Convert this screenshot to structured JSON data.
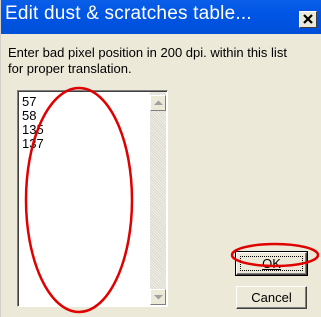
{
  "window": {
    "title": "Edit dust & scratches table...",
    "close_icon": "close-icon"
  },
  "instructions": {
    "line1": "Enter bad pixel position in 200 dpi. within  this list",
    "line2": "for proper translation."
  },
  "list": {
    "items": [
      "57",
      "58",
      "135",
      "137"
    ]
  },
  "buttons": {
    "ok": "OK",
    "cancel": "Cancel"
  },
  "annotations": {
    "color": "#e00000"
  },
  "colors": {
    "titlebar": "#0055e5",
    "dialog_bg": "#ece9d8"
  }
}
